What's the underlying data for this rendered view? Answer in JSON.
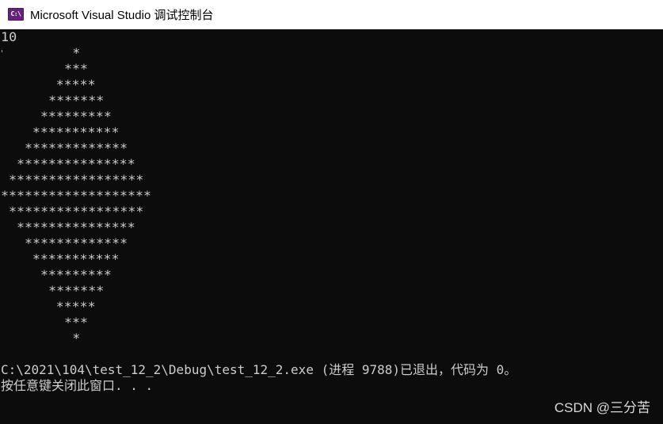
{
  "window": {
    "title": "Microsoft Visual Studio 调试控制台",
    "icon": "visual-studio-console-icon",
    "icon_glyph": "C:\\",
    "accent_color": "#68217a"
  },
  "console": {
    "background": "#0c0c0c",
    "text_color": "#cccccc",
    "lines": [
      "10",
      "         *",
      "        ***",
      "       *****",
      "      *******",
      "     *********",
      "    ***********",
      "   *************",
      "  ***************",
      " *****************",
      "*******************",
      " *****************",
      "  ***************",
      "   *************",
      "    ***********",
      "     *********",
      "      *******",
      "       *****",
      "        ***",
      "         *",
      "",
      "C:\\2021\\104\\test_12_2\\Debug\\test_12_2.exe (进程 9788)已退出，代码为 0。",
      "按任意键关闭此窗口. . ."
    ]
  },
  "watermark": {
    "text": "CSDN @三分苦"
  }
}
